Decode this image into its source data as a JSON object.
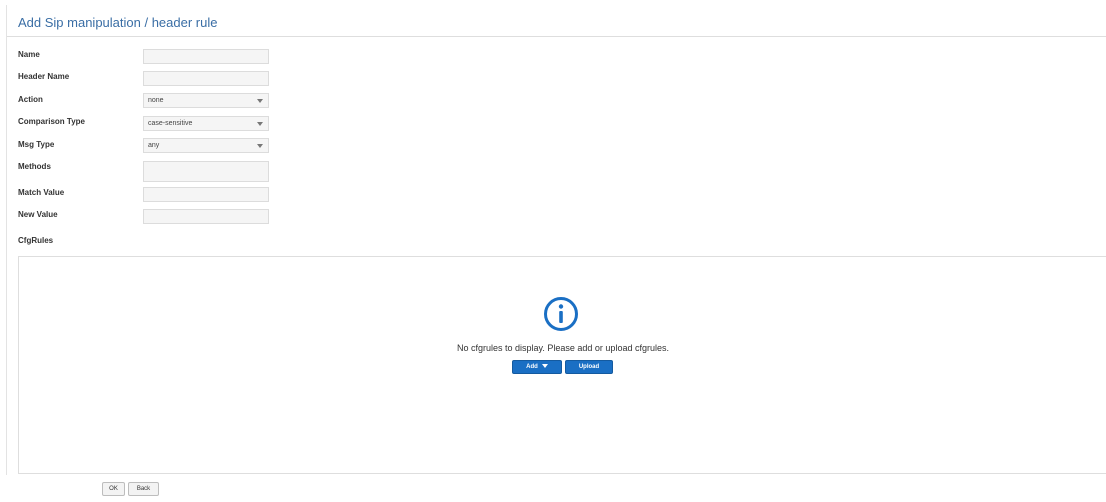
{
  "page": {
    "title": "Add Sip manipulation / header rule"
  },
  "form": {
    "name_label": "Name",
    "name_value": "",
    "header_name_label": "Header Name",
    "header_name_value": "",
    "action_label": "Action",
    "action_value": "none",
    "comparison_type_label": "Comparison Type",
    "comparison_type_value": "case-sensitive",
    "msg_type_label": "Msg Type",
    "msg_type_value": "any",
    "methods_label": "Methods",
    "methods_value": "",
    "match_value_label": "Match Value",
    "match_value_value": "",
    "new_value_label": "New Value",
    "new_value_value": "",
    "cfgrules_label": "CfgRules"
  },
  "rules_panel": {
    "icon": "info-circle-icon",
    "empty_message": "No cfgrules to display. Please add or upload cfgrules.",
    "add_label": "Add",
    "upload_label": "Upload"
  },
  "footer": {
    "ok_label": "OK",
    "back_label": "Back"
  },
  "colors": {
    "accent": "#1a6fc4",
    "title": "#3a6ea5"
  }
}
